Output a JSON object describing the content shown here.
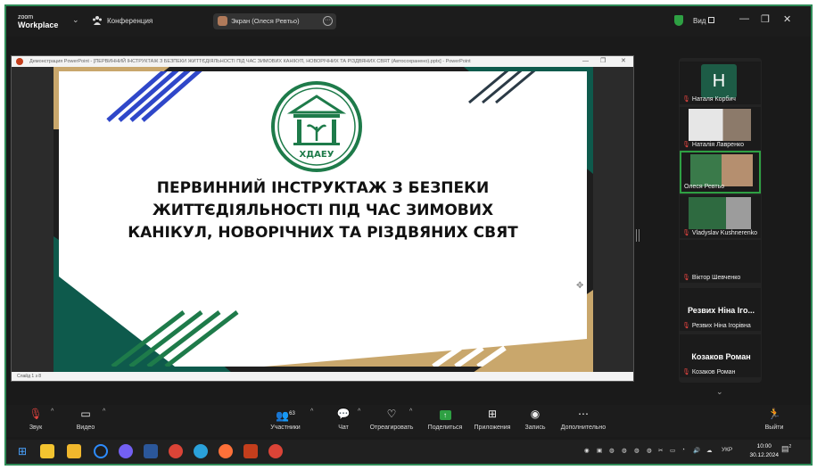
{
  "app": {
    "logo_line1": "zoom",
    "logo_line2": "Workplace",
    "meeting_label": "Конференция"
  },
  "share": {
    "label": "Экран (Олеся Ревтьо)",
    "menu": "···"
  },
  "view": {
    "label": "Вид"
  },
  "window_controls": {
    "minimize": "—",
    "restore": "❐",
    "close": "✕"
  },
  "ppt": {
    "title": "Демонстрация PowerPoint - [ПЕРВИННИЙ ІНСТРУКТАЖ З БЕЗПЕКИ ЖИТТЄДІЯЛЬНОСТІ ПІД ЧАС ЗИМОВИХ КАНІКУЛ, НОВОРІЧНИХ ТА РІЗДВЯНИХ СВЯТ (Автосохранено).pptx] - PowerPoint",
    "status": "Слайд 1 з 8"
  },
  "slide": {
    "emblem_text": "ХДАЕУ",
    "title_lines": [
      "ПЕРВИННИЙ ІНСТРУКТАЖ З БЕЗПЕКИ",
      "ЖИТТЄДІЯЛЬНОСТІ ПІД ЧАС ЗИМОВИХ",
      "КАНІКУЛ, НОВОРІЧНИХ ТА РІЗДВЯНИХ СВЯТ"
    ],
    "colors": {
      "green": "#1e7b4a",
      "blue": "#2f47c9",
      "navy": "#2b3a46",
      "gold": "#c9a76c",
      "teal": "#0e5a4c"
    }
  },
  "participants": [
    {
      "name": "Наталя Корбич",
      "avatar": "H"
    },
    {
      "name": "Наталія Лавренко"
    },
    {
      "name": "Олеся Ревтьо"
    },
    {
      "name": "Vladyslav Kushnerenko"
    },
    {
      "name": "Віктор Шевченко"
    },
    {
      "name": "Резвих Ніна Ігорівна",
      "big": "Резвих Ніна Ігo..."
    },
    {
      "name": "Козаков Роман",
      "big": "Козаков Роман"
    }
  ],
  "toolbar": {
    "audio": "Звук",
    "video": "Видео",
    "participants": "Участники",
    "participants_count": "63",
    "chat": "Чат",
    "react": "Отреагировать",
    "share": "Поделиться",
    "apps": "Приложения",
    "record": "Запись",
    "more": "Дополнительно",
    "leave": "Выйти"
  },
  "taskbar": {
    "lang": "УКР",
    "time": "10:00",
    "date": "30.12.2024",
    "notifications": "2"
  }
}
